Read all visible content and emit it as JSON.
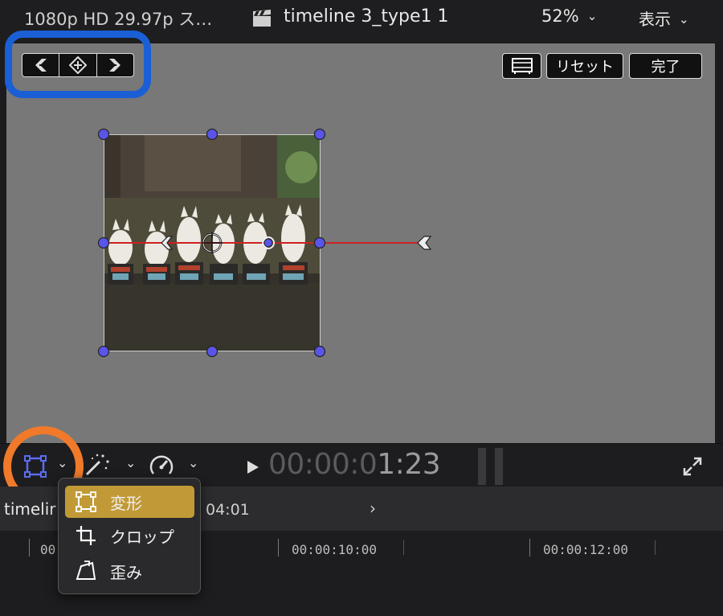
{
  "header": {
    "format": "1080p HD 29.97p ス…",
    "project_title": "timeline 3_type1 1",
    "zoom": "52%",
    "view_menu": "表示"
  },
  "viewer": {
    "reset_label": "リセット",
    "done_label": "完了"
  },
  "transport": {
    "timecode_dim": "00:00:0",
    "timecode_bright": "1:23"
  },
  "timeline": {
    "name": "timelir",
    "duration": "04:01",
    "ruler_labels": [
      "00",
      "00:00:10:00",
      "00:00:12:00"
    ]
  },
  "popup_menu": {
    "items": [
      {
        "label": "変形",
        "icon": "transform-icon",
        "selected": true
      },
      {
        "label": "クロップ",
        "icon": "crop-icon",
        "selected": false
      },
      {
        "label": "歪み",
        "icon": "distort-icon",
        "selected": false
      }
    ]
  },
  "colors": {
    "selection_blue": "#1a5fd6",
    "highlight_orange": "#f07a2a",
    "menu_selected": "#c19a37",
    "handle": "#5a55e8"
  }
}
